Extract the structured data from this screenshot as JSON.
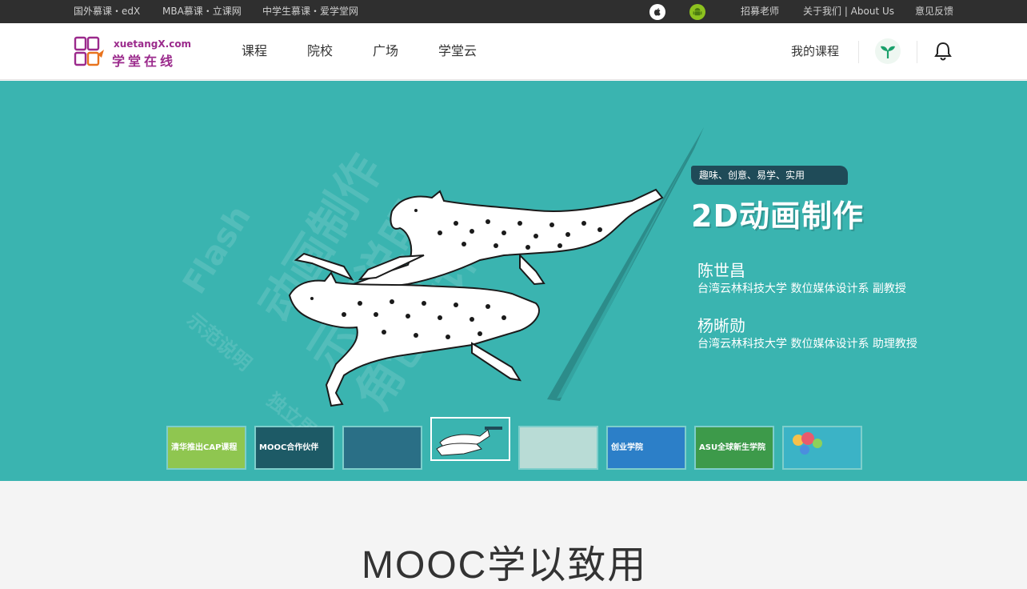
{
  "topbar": {
    "left_links": [
      "国外慕课・edX",
      "MBA慕课・立课网",
      "中学生慕课・爱学堂网"
    ],
    "right_links": [
      "招募老师",
      "关于我们 | About Us",
      "意见反馈"
    ],
    "os_icons": [
      "apple-icon",
      "android-icon"
    ]
  },
  "nav": {
    "logo_text_en": "xuetangX.com",
    "logo_text_cn": "学堂在线",
    "links": [
      "课程",
      "院校",
      "广场",
      "学堂云"
    ],
    "my_courses": "我的课程",
    "icons": [
      "avatar-sprout-icon",
      "bell-icon"
    ]
  },
  "banner": {
    "tagline": "趣味、创意、易学、实用",
    "title": "2D动画制作",
    "instructors": [
      {
        "name": "陈世昌",
        "desc": "台湾云林科技大学 数位媒体设计系 副教授"
      },
      {
        "name": "杨晰勋",
        "desc": "台湾云林科技大学 数位媒体设计系 助理教授"
      }
    ],
    "colors": {
      "background": "#3ab4b0",
      "tag": "#1f4b58"
    },
    "thumbnails": [
      {
        "caption": "清华推出CAP课程",
        "color": "#8fc650"
      },
      {
        "caption": "MOOC合作伙伴",
        "color": "#1d5a66"
      },
      {
        "caption": "",
        "color": "#2a6f86"
      },
      {
        "caption": "",
        "color": "#3ab4b0"
      },
      {
        "caption": "",
        "color": "#b9dcd6"
      },
      {
        "caption": "创业学院",
        "color": "#2c7fc8"
      },
      {
        "caption": "ASU全球新生学院",
        "color": "#3d9a4a"
      },
      {
        "caption": "",
        "color": "#3bb3c6"
      }
    ],
    "active_index": 3
  },
  "section": {
    "title": "MOOC学以致用"
  }
}
